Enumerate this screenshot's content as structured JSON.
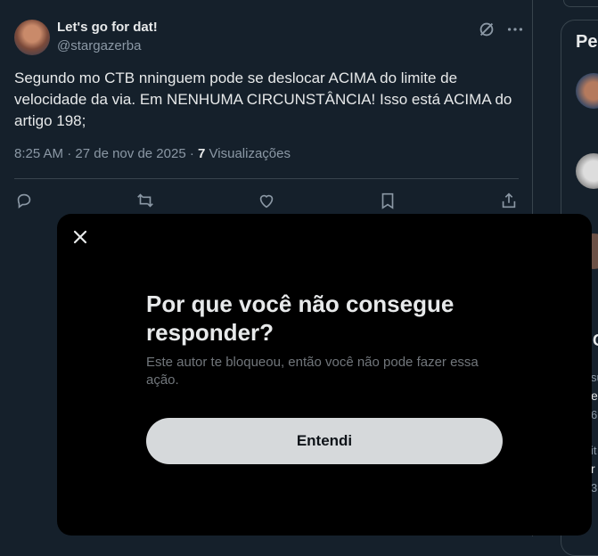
{
  "tweet": {
    "author_name": "Let's go for dat!",
    "handle": "@stargazerba",
    "text": "Segundo mo CTB nninguem pode se deslocar ACIMA do limite de velocidade da via. Em NENHUMA CIRCUNSTÂNCIA!  Isso está ACIMA do artigo 198;",
    "time": "8:25 AM",
    "date": "27 de nov de 2025",
    "views_count": "7",
    "views_label": "Visualizações"
  },
  "sidebar": {
    "title_fragment": "Pe",
    "fragments": [
      "C",
      "su",
      "e",
      "6",
      "it",
      "r",
      "3"
    ]
  },
  "modal": {
    "title": "Por que você não consegue responder?",
    "subtitle": "Este autor te bloqueou, então você não pode fazer essa ação.",
    "button_label": "Entendi"
  },
  "icons": {
    "reply": "reply-icon",
    "retweet": "retweet-icon",
    "like": "heart-icon",
    "bookmark": "bookmark-icon",
    "share": "share-icon",
    "grok": "grok-icon",
    "more": "more-icon",
    "close": "close-icon"
  },
  "colors": {
    "background": "#15202b",
    "modal": "#000000",
    "button": "#d6d9db",
    "muted": "#8b98a5"
  }
}
